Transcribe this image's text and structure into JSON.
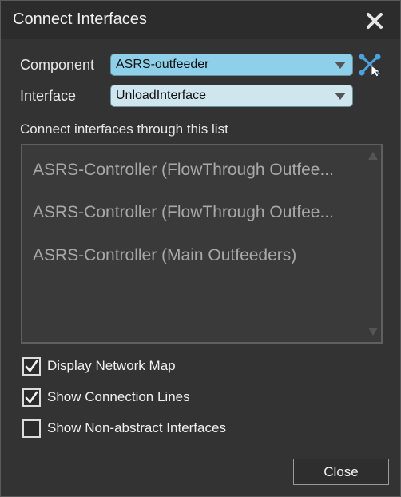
{
  "window": {
    "title": "Connect Interfaces",
    "close_icon": "close-icon"
  },
  "component": {
    "label": "Component",
    "value": "ASRS-outfeeder",
    "icon": "network-map-icon"
  },
  "interface": {
    "label": "Interface",
    "value": "UnloadInterface"
  },
  "list": {
    "caption": "Connect interfaces through this list",
    "items": [
      "ASRS-Controller (FlowThrough Outfee...",
      "ASRS-Controller (FlowThrough Outfee...",
      "ASRS-Controller (Main Outfeeders)"
    ]
  },
  "options": [
    {
      "label": "Display Network Map",
      "checked": true
    },
    {
      "label": "Show Connection Lines",
      "checked": true
    },
    {
      "label": "Show Non-abstract Interfaces",
      "checked": false
    }
  ],
  "footer": {
    "close_label": "Close"
  },
  "colors": {
    "component_field": "#8ed0ea",
    "interface_field": "#cfe6ee",
    "network_icon": "#4aa3df"
  }
}
